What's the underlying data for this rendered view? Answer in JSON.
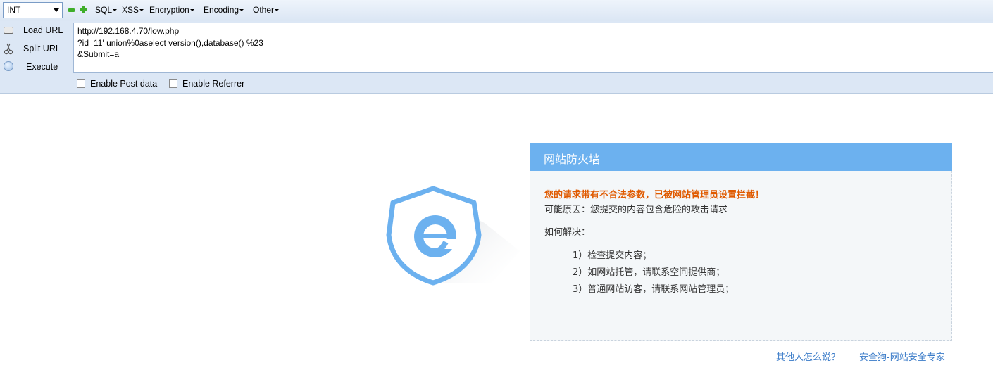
{
  "hackbar": {
    "select_value": "INT",
    "menus": [
      "SQL",
      "XSS",
      "Encryption",
      "Encoding",
      "Other"
    ],
    "buttons": {
      "load": "Load URL",
      "split": "Split URL",
      "execute": "Execute"
    },
    "url_lines": [
      "http://192.168.4.70/low.php",
      "?id=11' union%0aselect version(),database() %23",
      "&Submit=a"
    ],
    "enable_post": "Enable Post data",
    "enable_referrer": "Enable Referrer"
  },
  "firewall": {
    "title": "网站防火墙",
    "warning": "您的请求带有不合法参数，已被网站管理员设置拦截！",
    "reason": "可能原因：您提交的内容包含危险的攻击请求",
    "solution_label": "如何解决：",
    "steps": [
      "1）检查提交内容；",
      "2）如网站托管，请联系空间提供商；",
      "3）普通网站访客，请联系网站管理员；"
    ],
    "links": {
      "others": "其他人怎么说？",
      "brand": "安全狗-网站安全专家"
    },
    "accent_color": "#6cb1ef",
    "warning_color": "#e05a00"
  }
}
